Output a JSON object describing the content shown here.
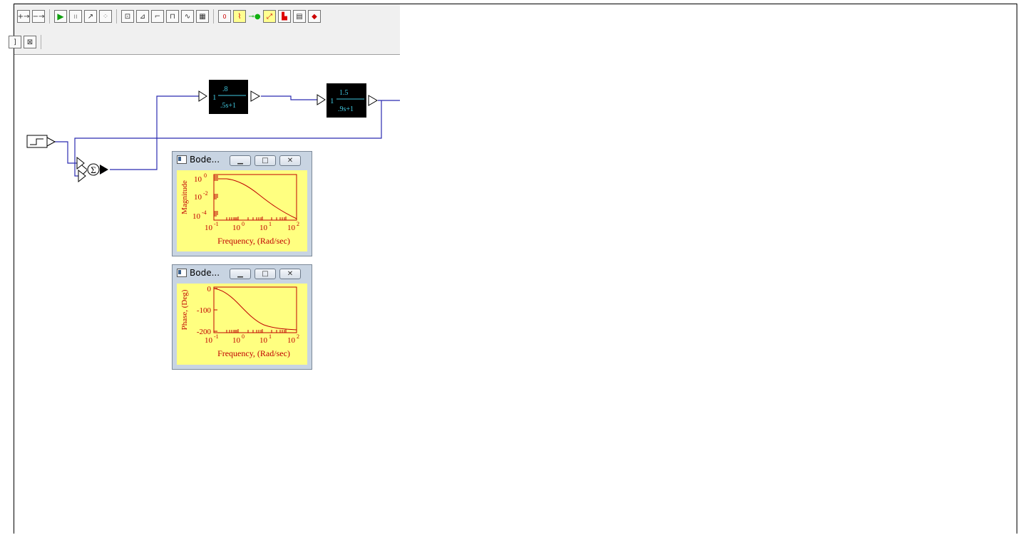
{
  "toolbar": {
    "row1": [
      {
        "name": "link-add-button",
        "icon": "link-plus-icon"
      },
      {
        "name": "link-remove-button",
        "icon": "link-minus-icon"
      },
      {
        "name": "run-button",
        "icon": "play-icon"
      },
      {
        "name": "pause-button",
        "icon": "pause-icon"
      },
      {
        "name": "step-button",
        "icon": "step-icon"
      },
      {
        "name": "continue-button",
        "icon": "continue-icon"
      },
      {
        "name": "const-block-button",
        "icon": "const-block-icon"
      },
      {
        "name": "ramp-block-button",
        "icon": "ramp-block-icon"
      },
      {
        "name": "step-block-button",
        "icon": "step-block-icon"
      },
      {
        "name": "pulse-block-button",
        "icon": "pulse-block-icon"
      },
      {
        "name": "sinewave-block-button",
        "icon": "sinewave-block-icon"
      },
      {
        "name": "table-block-button",
        "icon": "table-block-icon"
      },
      {
        "name": "display-block-button",
        "icon": "display-block-icon"
      },
      {
        "name": "plot-block-button",
        "icon": "plot-block-icon"
      },
      {
        "name": "led-block-button",
        "icon": "led-block-icon"
      },
      {
        "name": "xy-plot-button",
        "icon": "xy-plot-icon"
      },
      {
        "name": "histogram-button",
        "icon": "histogram-icon"
      },
      {
        "name": "meter-block-button",
        "icon": "meter-block-icon"
      },
      {
        "name": "stop-block-button",
        "icon": "stop-block-icon"
      }
    ],
    "row2": [
      {
        "name": "partial-block-button",
        "icon": "partial-block-icon"
      },
      {
        "name": "matrix-block-button",
        "icon": "matrix-block-icon"
      }
    ]
  },
  "blocks": {
    "tf1": {
      "gain": "1",
      "num": ".8",
      "den": ".5s+1"
    },
    "tf2": {
      "gain": "1",
      "num": "1.5",
      "den": ".9s+1"
    },
    "summing_symbol": "Σ"
  },
  "bode_magnitude": {
    "title": "Bode...",
    "ylabel": "Magnitude",
    "xlabel": "Frequency, (Rad/sec)",
    "y_ticks": [
      "10",
      "10",
      "10"
    ],
    "y_exps": [
      "0",
      "-2",
      "-4"
    ],
    "x_ticks": [
      "10",
      "10",
      "10",
      "10"
    ],
    "x_exps": [
      "-1",
      "0",
      "1",
      "2"
    ]
  },
  "bode_phase": {
    "title": "Bode...",
    "ylabel": "Phase, (Deg)",
    "xlabel": "Frequency, (Rad/sec)",
    "y_ticks": [
      "0",
      "-100",
      "-200"
    ],
    "x_ticks": [
      "10",
      "10",
      "10",
      "10"
    ],
    "x_exps": [
      "-1",
      "0",
      "1",
      "2"
    ]
  },
  "colors": {
    "wire": "#2b2bb0",
    "plot_bg": "#ffff80",
    "plot_ink": "#c00000",
    "block_bg": "#000000",
    "block_text": "#40c8e0"
  }
}
